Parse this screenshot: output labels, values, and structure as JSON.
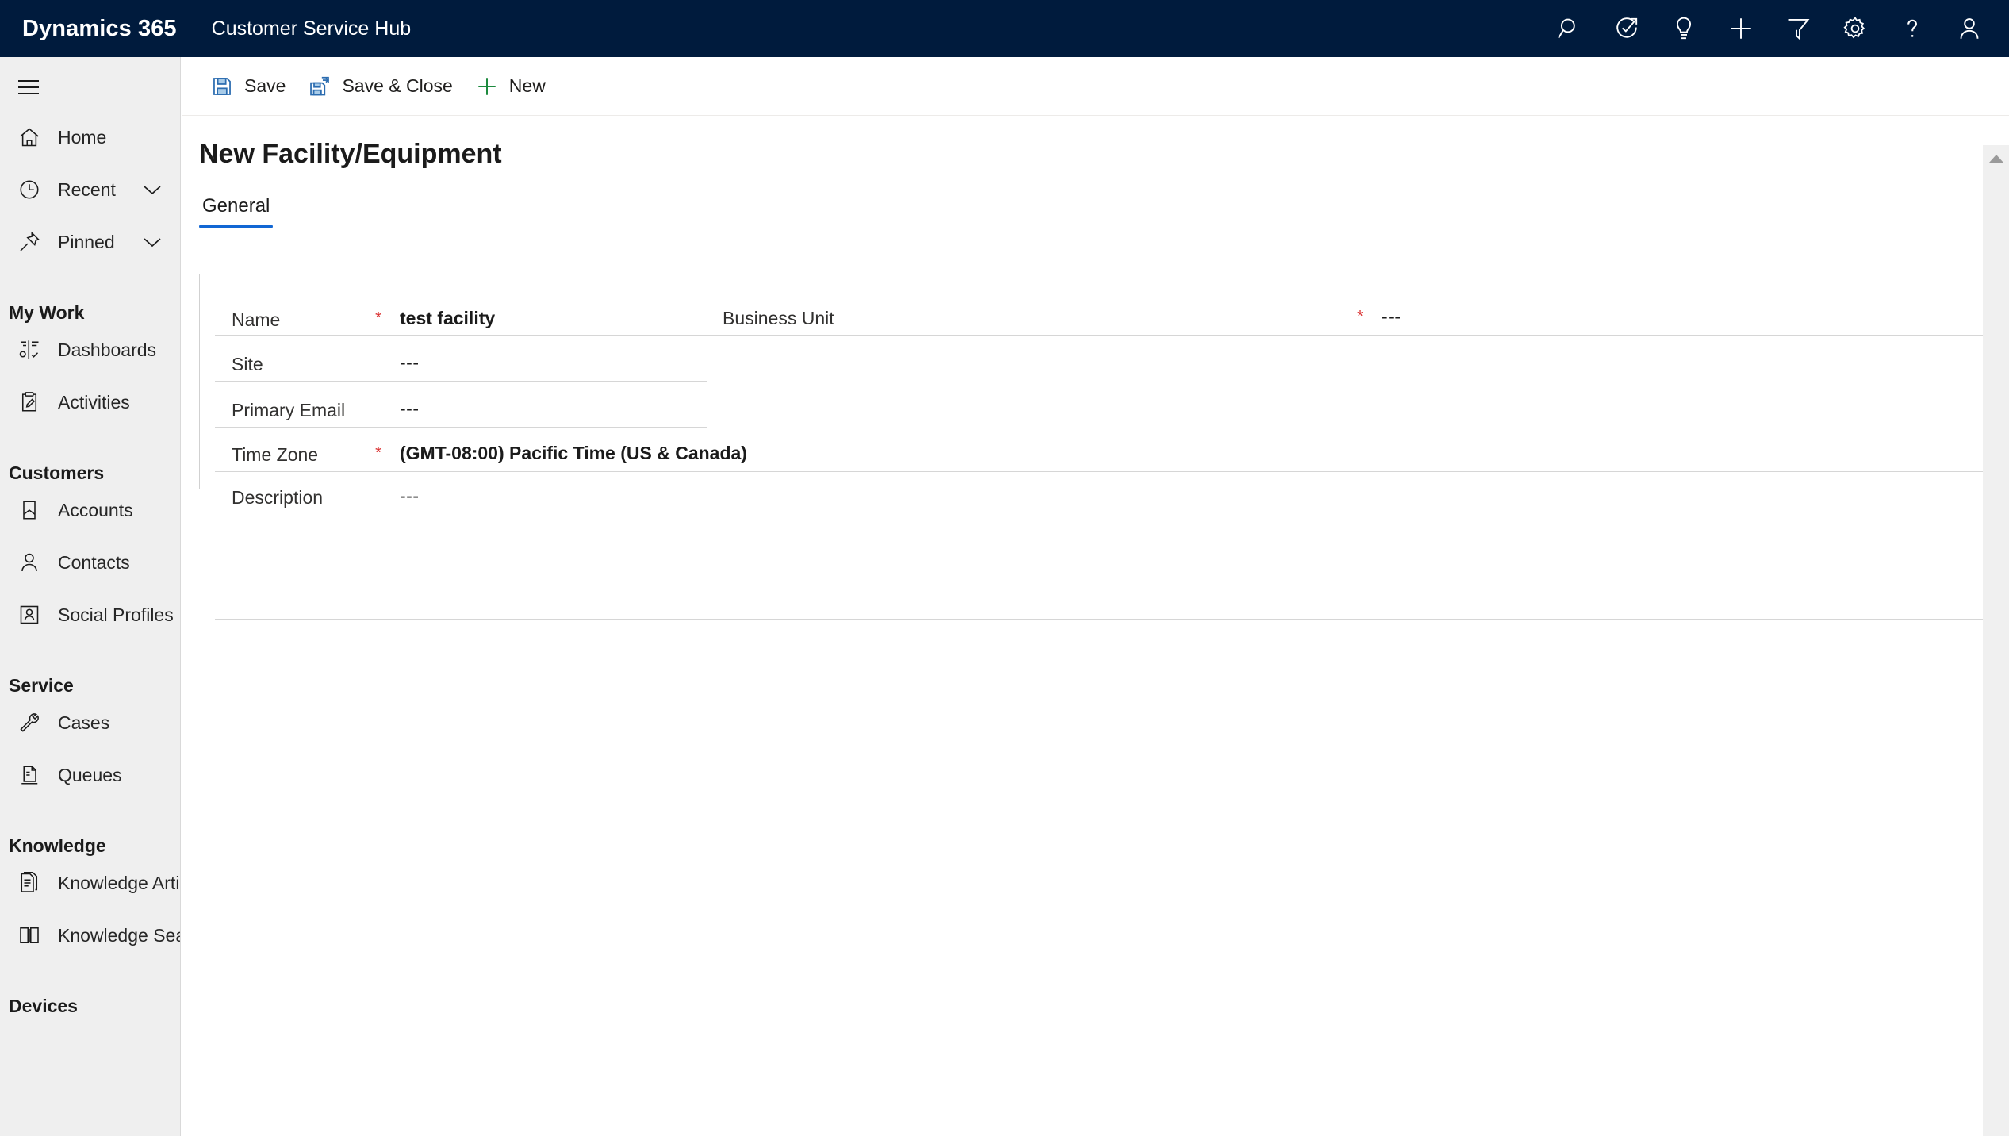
{
  "appbar": {
    "brand": "Dynamics 365",
    "app_title": "Customer Service Hub",
    "actions": [
      {
        "name": "search-icon",
        "label": "Search"
      },
      {
        "name": "assistant-icon",
        "label": "Assistant"
      },
      {
        "name": "lightbulb-icon",
        "label": "Insights"
      },
      {
        "name": "plus-icon",
        "label": "Quick create"
      },
      {
        "name": "filter-icon",
        "label": "Filter"
      },
      {
        "name": "gear-icon",
        "label": "Settings"
      },
      {
        "name": "help-icon",
        "label": "Help"
      },
      {
        "name": "user-avatar-icon",
        "label": "Account manager"
      }
    ]
  },
  "sidebar": {
    "hamburger_label": "Expand / collapse site map",
    "top_items": [
      {
        "label": "Home",
        "icon": "home-icon",
        "chevron": false
      },
      {
        "label": "Recent",
        "icon": "clock-icon",
        "chevron": true
      },
      {
        "label": "Pinned",
        "icon": "pin-icon",
        "chevron": true
      }
    ],
    "groups": [
      {
        "title": "My Work",
        "items": [
          {
            "label": "Dashboards",
            "icon": "dashboard-icon"
          },
          {
            "label": "Activities",
            "icon": "activities-icon"
          }
        ]
      },
      {
        "title": "Customers",
        "items": [
          {
            "label": "Accounts",
            "icon": "accounts-icon"
          },
          {
            "label": "Contacts",
            "icon": "contact-icon"
          },
          {
            "label": "Social Profiles",
            "icon": "social-profile-icon"
          }
        ]
      },
      {
        "title": "Service",
        "items": [
          {
            "label": "Cases",
            "icon": "wrench-icon"
          },
          {
            "label": "Queues",
            "icon": "queue-icon"
          }
        ]
      },
      {
        "title": "Knowledge",
        "items": [
          {
            "label": "Knowledge Articles",
            "icon": "article-icon"
          },
          {
            "label": "Knowledge Search",
            "icon": "book-icon"
          }
        ]
      },
      {
        "title": "Devices",
        "items": []
      }
    ]
  },
  "commandbar": {
    "buttons": [
      {
        "label": "Save",
        "icon": "save-icon"
      },
      {
        "label": "Save & Close",
        "icon": "save-and-close-icon"
      },
      {
        "label": "New",
        "icon": "new-plus-icon"
      }
    ]
  },
  "form": {
    "title": "New Facility/Equipment",
    "tabs": [
      {
        "label": "General",
        "active": true
      }
    ],
    "fields": {
      "name": {
        "label": "Name",
        "required": true,
        "value": "test facility"
      },
      "site": {
        "label": "Site",
        "required": false,
        "value": "---"
      },
      "primary_email": {
        "label": "Primary Email",
        "required": false,
        "value": "---"
      },
      "time_zone": {
        "label": "Time Zone",
        "required": true,
        "value": "(GMT-08:00) Pacific Time (US & Canada)"
      },
      "description": {
        "label": "Description",
        "required": false,
        "value": "---"
      },
      "business_unit": {
        "label": "Business Unit",
        "required": true,
        "value": "---"
      }
    },
    "required_marker": "*"
  },
  "scrollbar": {
    "up_label": "Scroll up"
  },
  "colors": {
    "appbar_bg": "#001b3d",
    "sidebar_bg": "#efefef",
    "accent_blue": "#1267d4",
    "required_red": "#d92b2b",
    "new_green": "#1d8a3e",
    "save_blue": "#2b6cb0"
  }
}
